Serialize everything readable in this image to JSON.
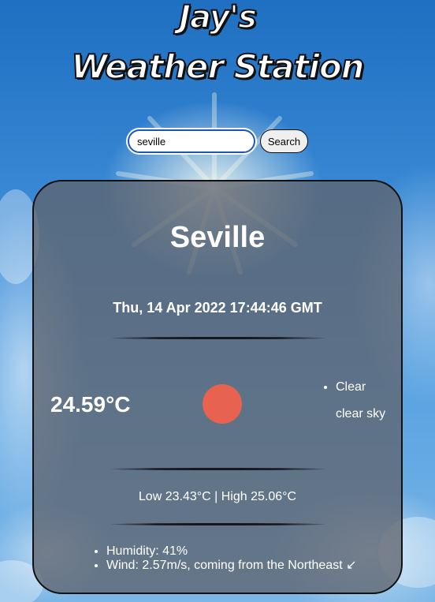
{
  "header": {
    "title_line1": "Jay's",
    "title_line2": "Weather Station"
  },
  "search": {
    "value": "seville",
    "button_label": "Search"
  },
  "weather": {
    "city": "Seville",
    "datetime": "Thu, 14 Apr 2022 17:44:46 GMT",
    "temperature": "24.59°C",
    "icon": "sun-icon",
    "icon_color": "#e8634f",
    "conditions": [
      "Clear",
      "clear sky"
    ],
    "low_high": "Low 23.43°C | High 25.06°C",
    "details": [
      "Humidity: 41%",
      "Wind: 2.57m/s, coming from the Northeast ↙"
    ]
  },
  "colors": {
    "card_background": "#5f646e",
    "input_border": "#1a56b8"
  }
}
